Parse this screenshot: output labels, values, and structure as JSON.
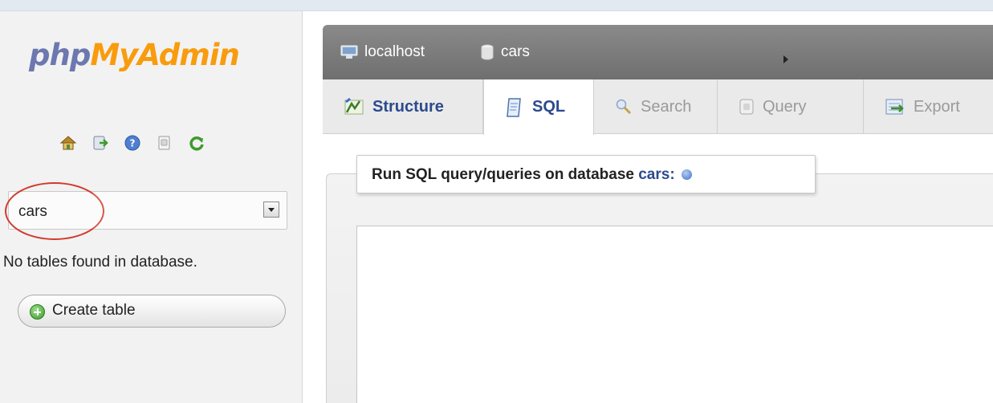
{
  "logo": {
    "php": "php",
    "myadmin": "MyAdmin"
  },
  "nav_icons": [
    "home-icon",
    "exit-icon",
    "help-icon",
    "docs-icon",
    "reload-icon"
  ],
  "db_select": {
    "value": "cars"
  },
  "nav_message": "No tables found in database.",
  "create_table_label": "Create table",
  "breadcrumb": {
    "server": "localhost",
    "database": "cars"
  },
  "tabs": [
    {
      "label": "Structure",
      "icon": "structure-icon",
      "state": "normal"
    },
    {
      "label": "SQL",
      "icon": "sql-icon",
      "state": "active"
    },
    {
      "label": "Search",
      "icon": "search-icon",
      "state": "disabled"
    },
    {
      "label": "Query",
      "icon": "query-icon",
      "state": "disabled"
    },
    {
      "label": "Export",
      "icon": "export-icon",
      "state": "normal"
    }
  ],
  "sql_panel": {
    "legend_prefix": "Run SQL query/queries on database",
    "db_name": "cars:",
    "query": ""
  },
  "colors": {
    "logo_php": "#6c78af",
    "logo_myadmin": "#f89c0e",
    "link": "#2c4a8d",
    "annotation_circle": "#d23a2e",
    "breadcrumb_bar": "#7d7d7d"
  }
}
